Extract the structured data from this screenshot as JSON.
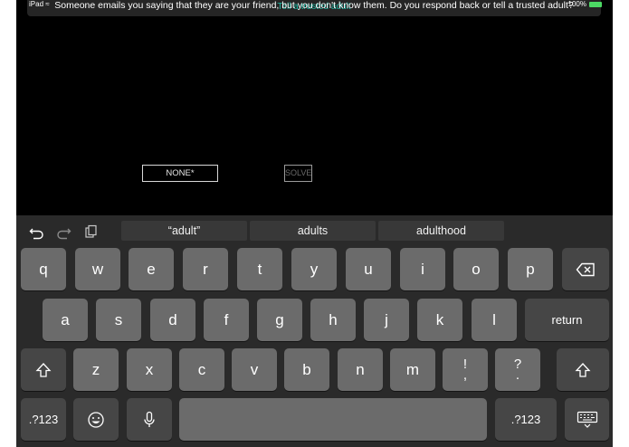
{
  "status": {
    "left": "iPad",
    "battery": "100%"
  },
  "question": {
    "text": "Someone emails you saying that they are your friend, but you don't know them. Do you respond back or tell a trusted adult?",
    "overlap_text": "Tell a trusted adult"
  },
  "answers": {
    "none_label": "NONE*",
    "solve_label": "SOLVE"
  },
  "keyboard": {
    "suggestions": [
      "“adult”",
      "adults",
      "adulthood"
    ],
    "row1": [
      "q",
      "w",
      "e",
      "r",
      "t",
      "y",
      "u",
      "i",
      "o",
      "p"
    ],
    "row2": [
      "a",
      "s",
      "d",
      "f",
      "g",
      "h",
      "j",
      "k",
      "l"
    ],
    "row3": [
      "z",
      "x",
      "c",
      "v",
      "b",
      "n",
      "m"
    ],
    "punct1": [
      "!",
      ","
    ],
    "punct2": [
      "?",
      "."
    ],
    "return_label": "return",
    "numbers_left": ".?123",
    "numbers_right": ".?123"
  }
}
